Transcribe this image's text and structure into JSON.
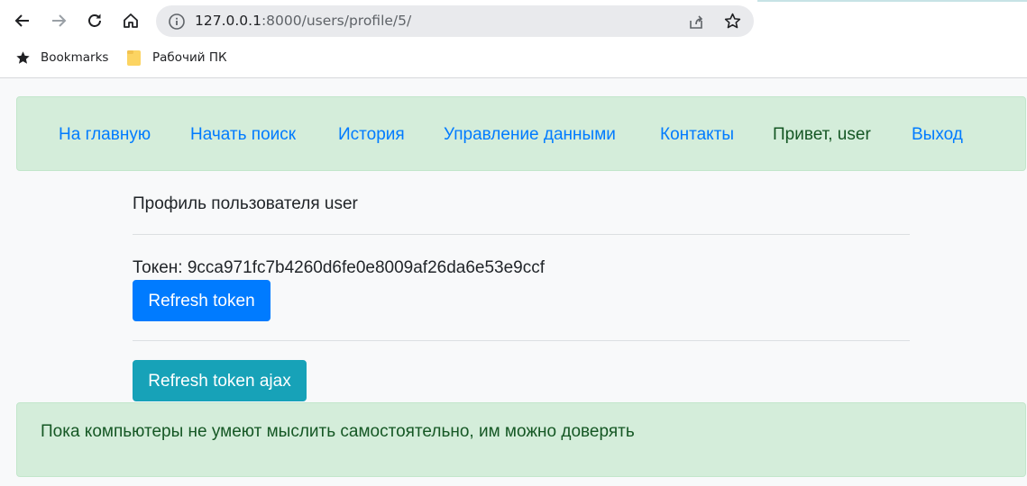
{
  "browser": {
    "url_host": "127.0.0.1",
    "url_path": ":8000/users/profile/5/",
    "bookmarks": [
      {
        "label": "Bookmarks",
        "icon": "star-icon"
      },
      {
        "label": "Рабочий ПК",
        "icon": "folder-icon"
      }
    ]
  },
  "nav": {
    "home": "На главную",
    "search": "Начать поиск",
    "history": "История",
    "data": "Управление данными",
    "contacts": "Контакты",
    "greeting": "Привет, user",
    "logout": "Выход"
  },
  "profile": {
    "title": "Профиль пользователя user",
    "token_label": "Токен: 9cca971fc7b4260d6fe0e8009af26da6e53e9ccf",
    "refresh_button": "Refresh token",
    "refresh_ajax_button": "Refresh token ajax"
  },
  "footer": {
    "quote": "Пока компьютеры не умеют мыслить самостоятельно, им можно доверять"
  },
  "colors": {
    "link": "#007bff",
    "success_bg": "#d4edda",
    "success_text": "#155724",
    "primary": "#007bff",
    "info": "#17a2b8"
  }
}
